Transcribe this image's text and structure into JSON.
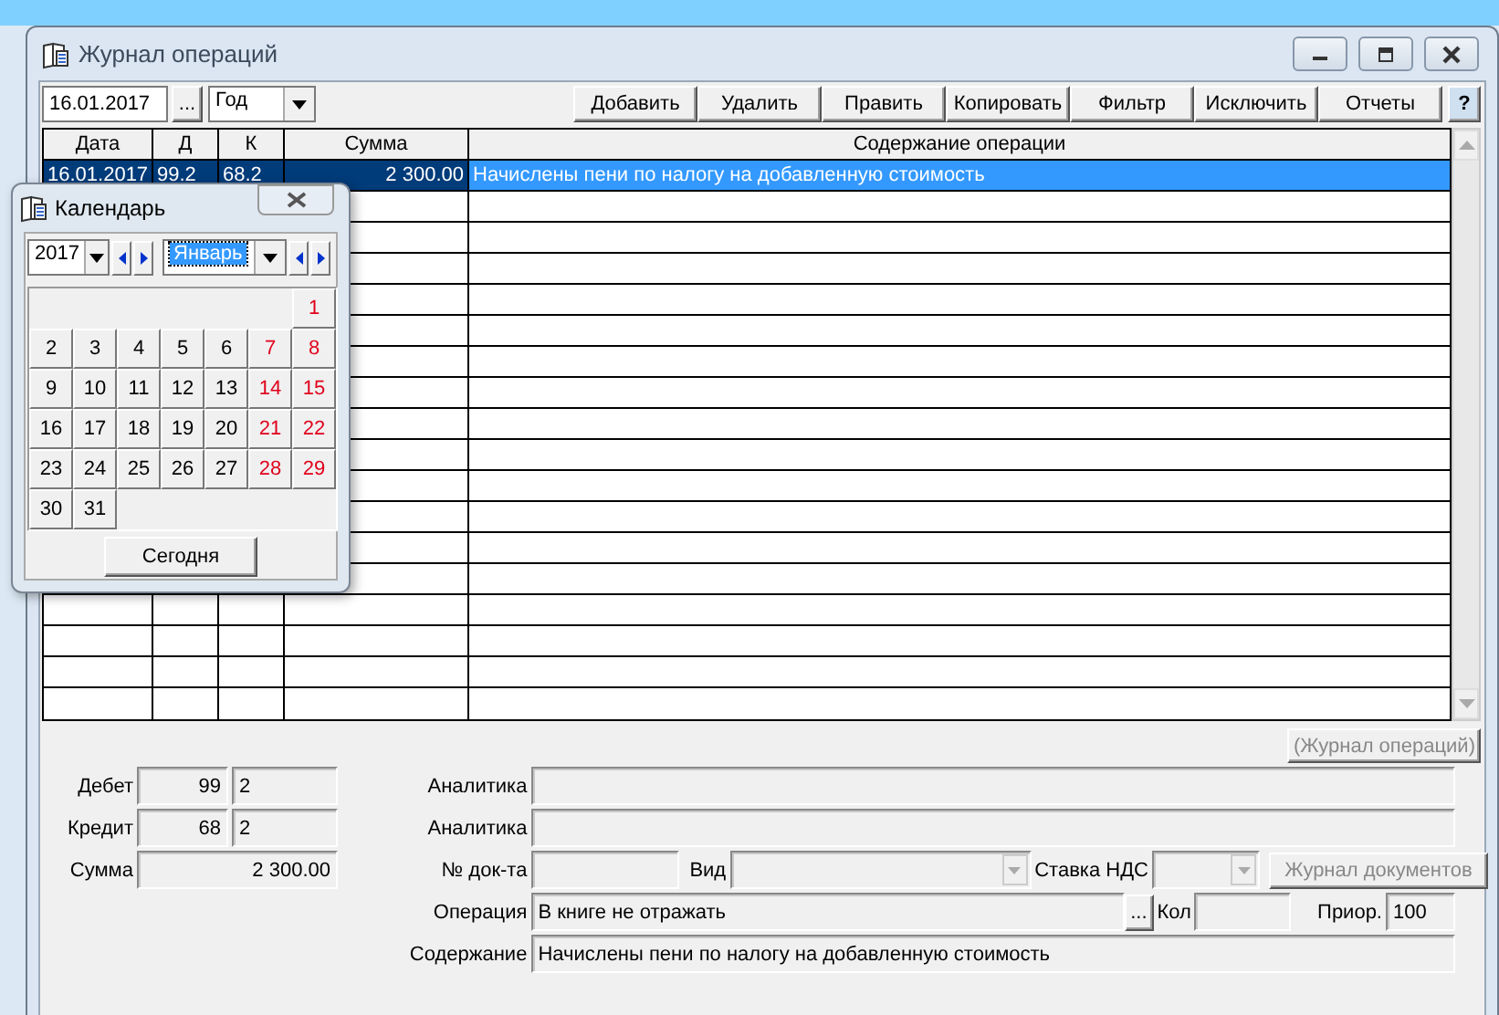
{
  "window": {
    "title": "Журнал операций"
  },
  "toolbar": {
    "date": "16.01.2017",
    "date_button": "...",
    "period": "Год",
    "buttons": [
      "Добавить",
      "Удалить",
      "Править",
      "Копировать",
      "Фильтр",
      "Исключить",
      "Отчеты"
    ],
    "help": "?"
  },
  "table": {
    "columns": [
      "Дата",
      "Д",
      "К",
      "Сумма",
      "Содержание операции"
    ],
    "rows": [
      {
        "cells": [
          "16.01.2017",
          "99.2",
          "68.2",
          "2 300.00",
          "Начислены пени по налогу на  добавленную стоимость"
        ],
        "selected": true
      }
    ]
  },
  "calendar": {
    "title": "Календарь",
    "year": "2017",
    "month": "Январь",
    "today_button": "Сегодня",
    "days": [
      {
        "label": "1",
        "weekend": true
      },
      {
        "label": "2",
        "weekend": false
      },
      {
        "label": "3",
        "weekend": false
      },
      {
        "label": "4",
        "weekend": false
      },
      {
        "label": "5",
        "weekend": false
      },
      {
        "label": "6",
        "weekend": false
      },
      {
        "label": "7",
        "weekend": true
      },
      {
        "label": "8",
        "weekend": true
      },
      {
        "label": "9",
        "weekend": false
      },
      {
        "label": "10",
        "weekend": false
      },
      {
        "label": "11",
        "weekend": false
      },
      {
        "label": "12",
        "weekend": false
      },
      {
        "label": "13",
        "weekend": false
      },
      {
        "label": "14",
        "weekend": true
      },
      {
        "label": "15",
        "weekend": true
      },
      {
        "label": "16",
        "weekend": false
      },
      {
        "label": "17",
        "weekend": false
      },
      {
        "label": "18",
        "weekend": false
      },
      {
        "label": "19",
        "weekend": false
      },
      {
        "label": "20",
        "weekend": false
      },
      {
        "label": "21",
        "weekend": true
      },
      {
        "label": "22",
        "weekend": true
      },
      {
        "label": "23",
        "weekend": false
      },
      {
        "label": "24",
        "weekend": false
      },
      {
        "label": "25",
        "weekend": false
      },
      {
        "label": "26",
        "weekend": false
      },
      {
        "label": "27",
        "weekend": false
      },
      {
        "label": "28",
        "weekend": true
      },
      {
        "label": "29",
        "weekend": true
      },
      {
        "label": "30",
        "weekend": false
      },
      {
        "label": "31",
        "weekend": false
      }
    ]
  },
  "details": {
    "journal_button": {
      "label": "(Журнал операций)",
      "disabled": true
    },
    "debit": {
      "label": "Дебет",
      "account": "99",
      "sub": "2"
    },
    "credit": {
      "label": "Кредит",
      "account": "68",
      "sub": "2"
    },
    "sum": {
      "label": "Сумма",
      "value": "2 300.00"
    },
    "analytics": [
      "Аналитика",
      "Аналитика"
    ],
    "doc_no_label": "№ док-та",
    "kind_label": "Вид",
    "vat_label": "Ставка НДС",
    "documents_button": {
      "label": "Журнал документов",
      "disabled": true
    },
    "operation": {
      "label": "Операция",
      "value": "В книге не отражать",
      "button": "..."
    },
    "qty_label": "Кол",
    "priority": {
      "label": "Приор.",
      "value": "100"
    },
    "content": {
      "label": "Содержание",
      "value": "Начислены пени по налогу на  добавленную стоимость"
    }
  }
}
